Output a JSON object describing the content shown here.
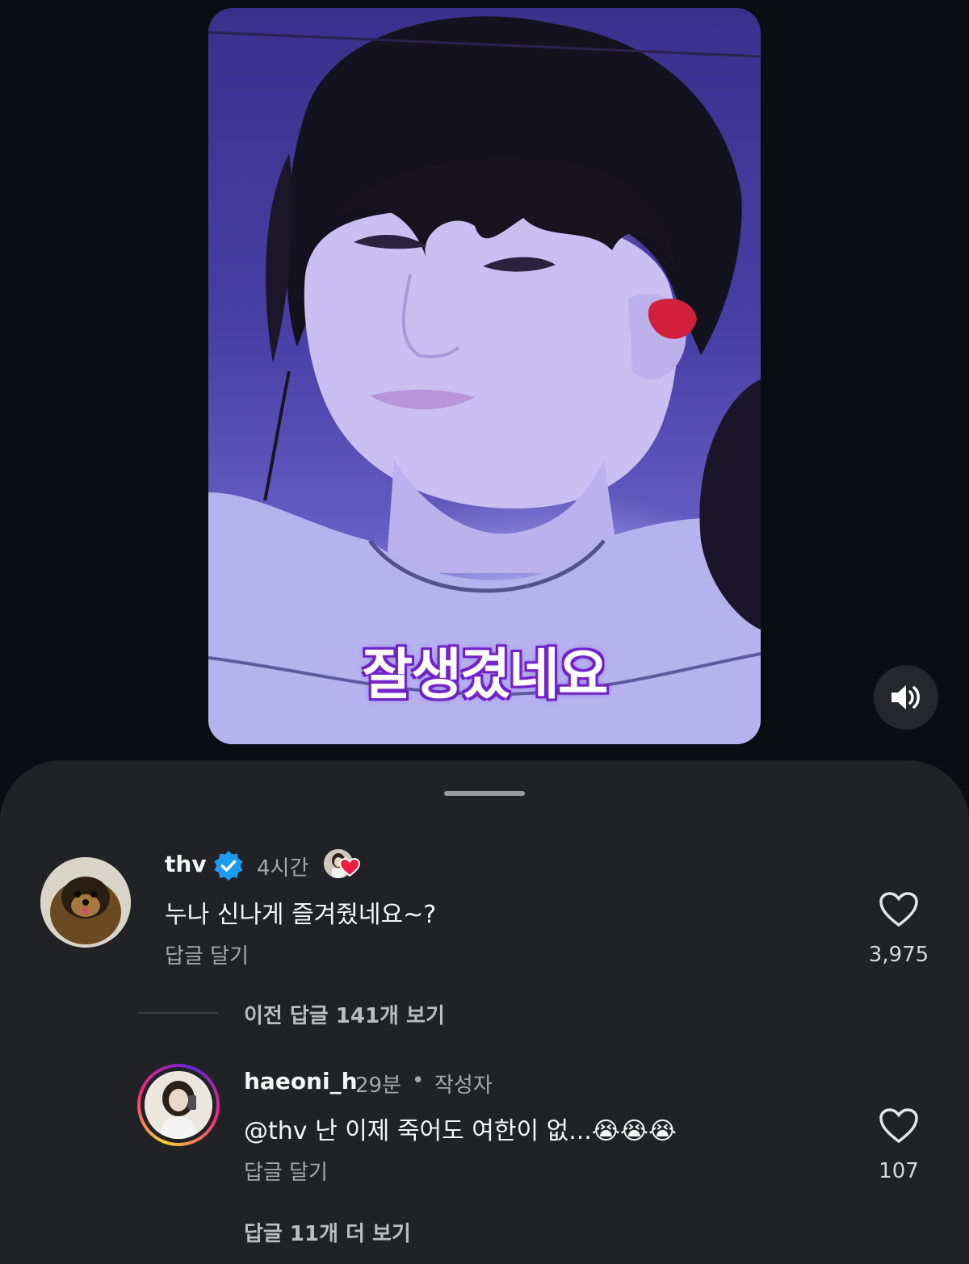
{
  "video": {
    "caption": "잘생겼네요"
  },
  "sound_button": {
    "icon": "speaker-icon"
  },
  "comments": [
    {
      "username": "thv",
      "verified": true,
      "time": "4시간",
      "text": "누나 신나게 즐겨줬네요~?",
      "reply_label": "답글 달기",
      "likes": "3,975"
    }
  ],
  "view_previous_replies": "이전 답글 141개 보기",
  "reply": {
    "username": "haeoni_h",
    "time": "29분",
    "separator": "•",
    "author_badge": "작성자",
    "text": "@thv 난 이제 죽어도 여한이 없...😭😭😭",
    "reply_label": "답글 달기",
    "likes": "107"
  },
  "view_more_replies": "답글 11개 더 보기",
  "colors": {
    "background": "#0a0e12",
    "sheet": "#202226",
    "verified_blue": "#1d9bf0",
    "caption_glow": "#7d2fd0",
    "story_ring": "#e1306c"
  }
}
